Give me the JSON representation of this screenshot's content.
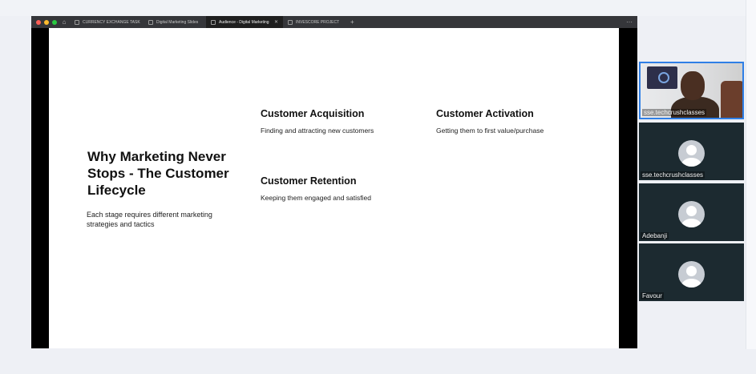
{
  "browser": {
    "tabs": [
      {
        "label": "CURRENCY EXCHANGE TASK",
        "active": false
      },
      {
        "label": "Digital Marketing Slides",
        "active": false
      },
      {
        "label": "Audience - Digital Marketing Slid",
        "active": true
      },
      {
        "label": "INVESCORE PROJECT",
        "active": false
      }
    ],
    "new_tab_symbol": "+",
    "menu_symbol": "···",
    "close_symbol": "✕",
    "window_dot_colors": [
      "#ff5f57",
      "#febc2e",
      "#28c840"
    ]
  },
  "slide": {
    "title": "Why Marketing Never Stops - The Customer Lifecycle",
    "subtitle": "Each stage requires different marketing strategies and tactics",
    "cards": [
      {
        "title": "Customer Acquisition",
        "text": "Finding and attracting new customers"
      },
      {
        "title": "Customer Activation",
        "text": "Getting them to first value/purchase"
      },
      {
        "title": "Customer Retention",
        "text": "Keeping them engaged and satisfied"
      }
    ]
  },
  "participants": [
    {
      "name": "sse.techcrushclasses",
      "video": true,
      "speaking": true
    },
    {
      "name": "sse.techcrushclasses",
      "video": false
    },
    {
      "name": "Adebanji",
      "video": false
    },
    {
      "name": "Favour",
      "video": false
    }
  ],
  "colors": {
    "active_speaker_border": "#2f7fe6",
    "tile_background": "#1c2a30"
  }
}
